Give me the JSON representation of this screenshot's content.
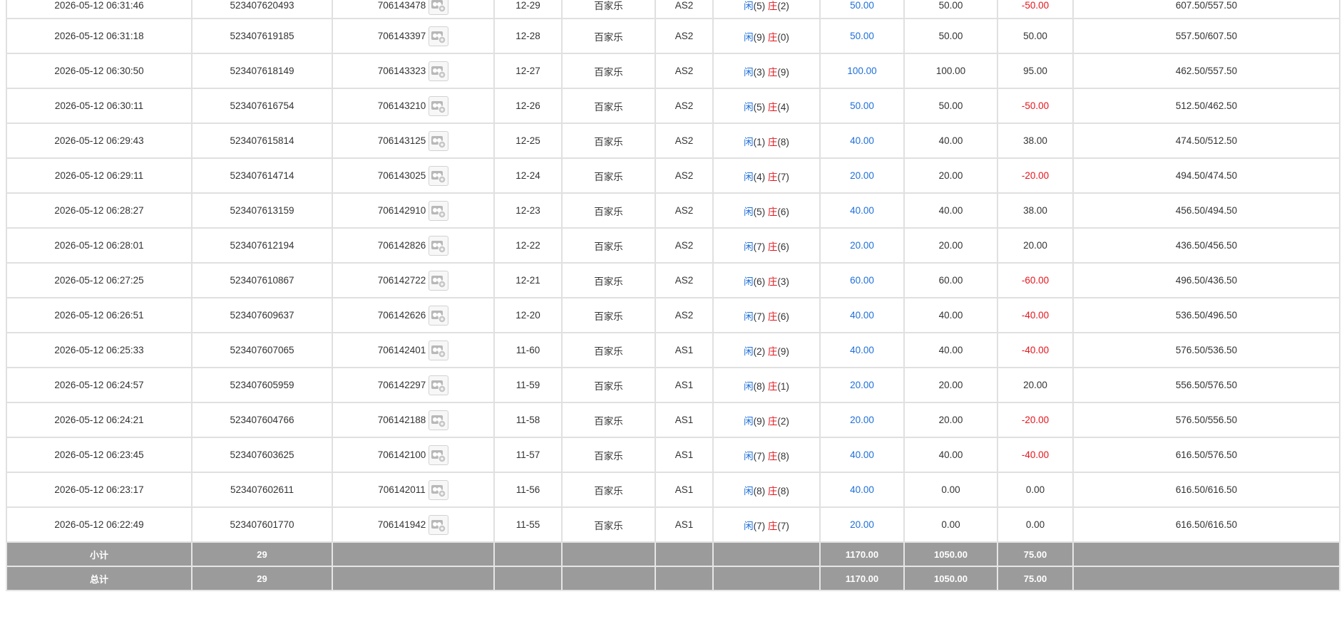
{
  "rows": [
    {
      "time": "2026-05-12 06:31:46",
      "order": "523407620493",
      "game_no": "706143478",
      "round": "12-29",
      "game": "百家乐",
      "table": "AS2",
      "player": "闲",
      "player_pts": "(5)",
      "banker": "庄",
      "banker_pts": "(2)",
      "bet": "50.00",
      "valid": "50.00",
      "win": "-50.00",
      "win_neg": true,
      "balance": "607.50/557.50"
    },
    {
      "time": "2026-05-12 06:31:18",
      "order": "523407619185",
      "game_no": "706143397",
      "round": "12-28",
      "game": "百家乐",
      "table": "AS2",
      "player": "闲",
      "player_pts": "(9)",
      "banker": "庄",
      "banker_pts": "(0)",
      "bet": "50.00",
      "valid": "50.00",
      "win": "50.00",
      "win_neg": false,
      "balance": "557.50/607.50"
    },
    {
      "time": "2026-05-12 06:30:50",
      "order": "523407618149",
      "game_no": "706143323",
      "round": "12-27",
      "game": "百家乐",
      "table": "AS2",
      "player": "闲",
      "player_pts": "(3)",
      "banker": "庄",
      "banker_pts": "(9)",
      "bet": "100.00",
      "valid": "100.00",
      "win": "95.00",
      "win_neg": false,
      "balance": "462.50/557.50"
    },
    {
      "time": "2026-05-12 06:30:11",
      "order": "523407616754",
      "game_no": "706143210",
      "round": "12-26",
      "game": "百家乐",
      "table": "AS2",
      "player": "闲",
      "player_pts": "(5)",
      "banker": "庄",
      "banker_pts": "(4)",
      "bet": "50.00",
      "valid": "50.00",
      "win": "-50.00",
      "win_neg": true,
      "balance": "512.50/462.50"
    },
    {
      "time": "2026-05-12 06:29:43",
      "order": "523407615814",
      "game_no": "706143125",
      "round": "12-25",
      "game": "百家乐",
      "table": "AS2",
      "player": "闲",
      "player_pts": "(1)",
      "banker": "庄",
      "banker_pts": "(8)",
      "bet": "40.00",
      "valid": "40.00",
      "win": "38.00",
      "win_neg": false,
      "balance": "474.50/512.50"
    },
    {
      "time": "2026-05-12 06:29:11",
      "order": "523407614714",
      "game_no": "706143025",
      "round": "12-24",
      "game": "百家乐",
      "table": "AS2",
      "player": "闲",
      "player_pts": "(4)",
      "banker": "庄",
      "banker_pts": "(7)",
      "bet": "20.00",
      "valid": "20.00",
      "win": "-20.00",
      "win_neg": true,
      "balance": "494.50/474.50"
    },
    {
      "time": "2026-05-12 06:28:27",
      "order": "523407613159",
      "game_no": "706142910",
      "round": "12-23",
      "game": "百家乐",
      "table": "AS2",
      "player": "闲",
      "player_pts": "(5)",
      "banker": "庄",
      "banker_pts": "(6)",
      "bet": "40.00",
      "valid": "40.00",
      "win": "38.00",
      "win_neg": false,
      "balance": "456.50/494.50"
    },
    {
      "time": "2026-05-12 06:28:01",
      "order": "523407612194",
      "game_no": "706142826",
      "round": "12-22",
      "game": "百家乐",
      "table": "AS2",
      "player": "闲",
      "player_pts": "(7)",
      "banker": "庄",
      "banker_pts": "(6)",
      "bet": "20.00",
      "valid": "20.00",
      "win": "20.00",
      "win_neg": false,
      "balance": "436.50/456.50"
    },
    {
      "time": "2026-05-12 06:27:25",
      "order": "523407610867",
      "game_no": "706142722",
      "round": "12-21",
      "game": "百家乐",
      "table": "AS2",
      "player": "闲",
      "player_pts": "(6)",
      "banker": "庄",
      "banker_pts": "(3)",
      "bet": "60.00",
      "valid": "60.00",
      "win": "-60.00",
      "win_neg": true,
      "balance": "496.50/436.50"
    },
    {
      "time": "2026-05-12 06:26:51",
      "order": "523407609637",
      "game_no": "706142626",
      "round": "12-20",
      "game": "百家乐",
      "table": "AS2",
      "player": "闲",
      "player_pts": "(7)",
      "banker": "庄",
      "banker_pts": "(6)",
      "bet": "40.00",
      "valid": "40.00",
      "win": "-40.00",
      "win_neg": true,
      "balance": "536.50/496.50"
    },
    {
      "time": "2026-05-12 06:25:33",
      "order": "523407607065",
      "game_no": "706142401",
      "round": "11-60",
      "game": "百家乐",
      "table": "AS1",
      "player": "闲",
      "player_pts": "(2)",
      "banker": "庄",
      "banker_pts": "(9)",
      "bet": "40.00",
      "valid": "40.00",
      "win": "-40.00",
      "win_neg": true,
      "balance": "576.50/536.50"
    },
    {
      "time": "2026-05-12 06:24:57",
      "order": "523407605959",
      "game_no": "706142297",
      "round": "11-59",
      "game": "百家乐",
      "table": "AS1",
      "player": "闲",
      "player_pts": "(8)",
      "banker": "庄",
      "banker_pts": "(1)",
      "bet": "20.00",
      "valid": "20.00",
      "win": "20.00",
      "win_neg": false,
      "balance": "556.50/576.50"
    },
    {
      "time": "2026-05-12 06:24:21",
      "order": "523407604766",
      "game_no": "706142188",
      "round": "11-58",
      "game": "百家乐",
      "table": "AS1",
      "player": "闲",
      "player_pts": "(9)",
      "banker": "庄",
      "banker_pts": "(2)",
      "bet": "20.00",
      "valid": "20.00",
      "win": "-20.00",
      "win_neg": true,
      "balance": "576.50/556.50"
    },
    {
      "time": "2026-05-12 06:23:45",
      "order": "523407603625",
      "game_no": "706142100",
      "round": "11-57",
      "game": "百家乐",
      "table": "AS1",
      "player": "闲",
      "player_pts": "(7)",
      "banker": "庄",
      "banker_pts": "(8)",
      "bet": "40.00",
      "valid": "40.00",
      "win": "-40.00",
      "win_neg": true,
      "balance": "616.50/576.50"
    },
    {
      "time": "2026-05-12 06:23:17",
      "order": "523407602611",
      "game_no": "706142011",
      "round": "11-56",
      "game": "百家乐",
      "table": "AS1",
      "player": "闲",
      "player_pts": "(8)",
      "banker": "庄",
      "banker_pts": "(8)",
      "bet": "40.00",
      "valid": "0.00",
      "win": "0.00",
      "win_neg": false,
      "balance": "616.50/616.50"
    },
    {
      "time": "2026-05-12 06:22:49",
      "order": "523407601770",
      "game_no": "706141942",
      "round": "11-55",
      "game": "百家乐",
      "table": "AS1",
      "player": "闲",
      "player_pts": "(7)",
      "banker": "庄",
      "banker_pts": "(7)",
      "bet": "20.00",
      "valid": "0.00",
      "win": "0.00",
      "win_neg": false,
      "balance": "616.50/616.50"
    }
  ],
  "subtotal": {
    "label": "小计",
    "count": "29",
    "bet": "1170.00",
    "valid": "1050.00",
    "win": "75.00"
  },
  "total": {
    "label": "总计",
    "count": "29",
    "bet": "1170.00",
    "valid": "1050.00",
    "win": "75.00"
  },
  "icons": {
    "replay": "game-record-icon"
  },
  "colors": {
    "player": "#1e6fd9",
    "banker": "#e4141b",
    "bet": "#1e6fd9",
    "negative": "#e4141b",
    "summary_bg": "#9b9b9b"
  }
}
